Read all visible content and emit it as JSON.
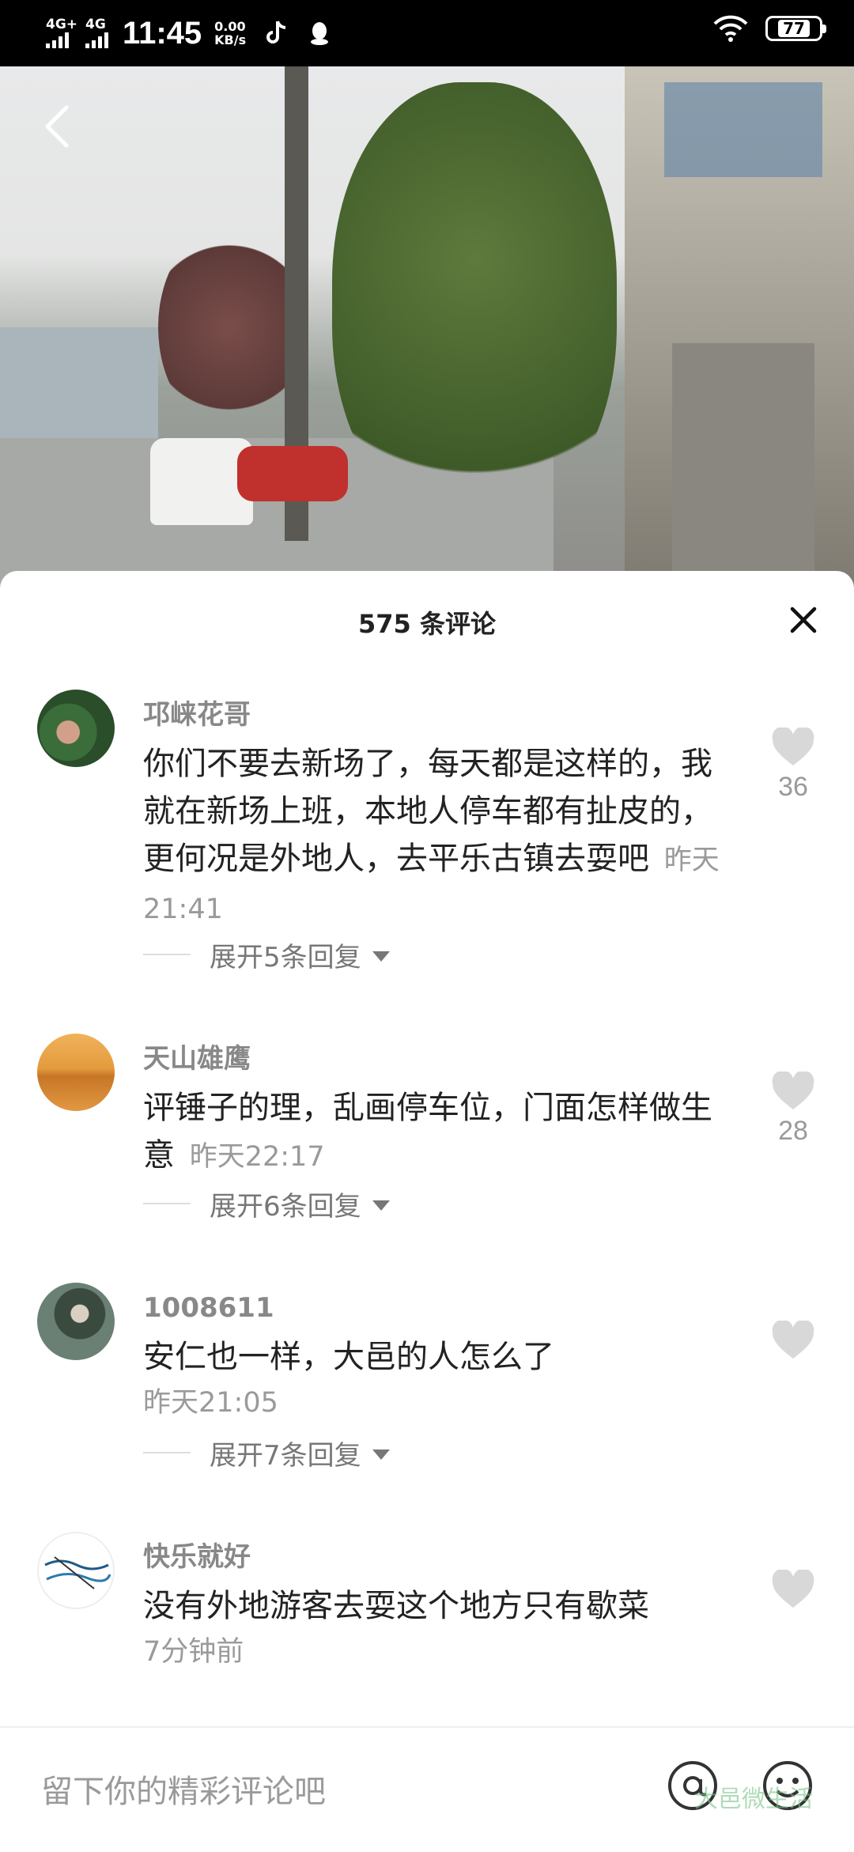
{
  "status_bar": {
    "sig1_label": "4G+",
    "sig2_label": "4G",
    "time": "11:45",
    "net_speed_value": "0.00",
    "net_speed_unit": "KB/s",
    "battery": "77"
  },
  "sheet": {
    "title": "575 条评论"
  },
  "comments": [
    {
      "name": "邛崃花哥",
      "text": "你们不要去新场了，每天都是这样的，我就在新场上班，本地人停车都有扯皮的，更何况是外地人，去平乐古镇去耍吧",
      "time": "昨天21:41",
      "likes": "36",
      "expand": "展开5条回复"
    },
    {
      "name": "天山雄鹰",
      "text": "评锤子的理，乱画停车位，门面怎样做生意",
      "time": "昨天22:17",
      "likes": "28",
      "expand": "展开6条回复"
    },
    {
      "name": "1008611",
      "text": "安仁也一样，大邑的人怎么了",
      "time": "昨天21:05",
      "likes": "",
      "expand": "展开7条回复"
    },
    {
      "name": "快乐就好",
      "text": "没有外地游客去耍这个地方只有歇菜",
      "time": "7分钟前",
      "likes": ""
    }
  ],
  "footer": {
    "placeholder": "留下你的精彩评论吧",
    "watermark": "大邑微生活"
  },
  "icons": {
    "back": "chevron-left-icon",
    "close": "close-icon",
    "like": "heart-icon",
    "at": "at-icon",
    "emoji": "emoji-icon"
  }
}
